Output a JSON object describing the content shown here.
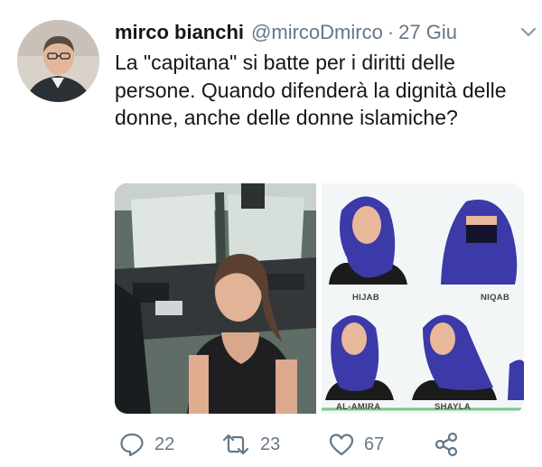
{
  "tweet": {
    "author_name": "mirco bianchi",
    "handle": "@mircoDmirco",
    "separator": "·",
    "date": "27 Giu",
    "text": "La \"capitana\" si batte per i diritti delle persone. Quando difenderà la dignità delle donne, anche delle donne islamiche?",
    "media": {
      "chart_labels": [
        "HIJAB",
        "NIQAB",
        "AL-AMIRA",
        "SHAYLA"
      ]
    },
    "actions": {
      "replies": "22",
      "retweets": "23",
      "likes": "67"
    }
  },
  "colors": {
    "text": "#14171a",
    "secondary": "#657786",
    "veil": "#3b3aa8"
  },
  "icons": [
    "chevron-down-icon",
    "reply-icon",
    "retweet-icon",
    "like-icon",
    "share-icon"
  ]
}
